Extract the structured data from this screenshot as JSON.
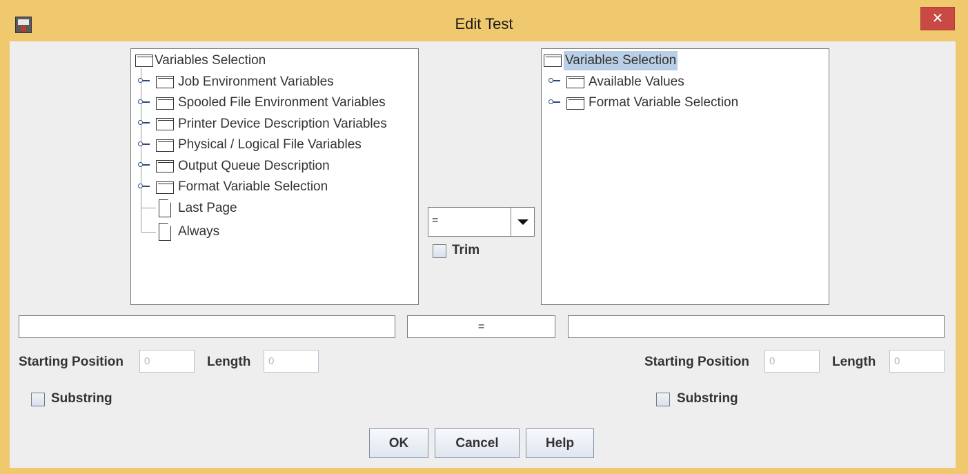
{
  "window": {
    "title": "Edit Test",
    "close_label": "✕"
  },
  "left_tree": {
    "root": "Variables Selection",
    "items": [
      "Job Environment Variables",
      "Spooled File Environment Variables",
      "Printer Device Description Variables",
      "Physical / Logical File Variables",
      "Output Queue Description",
      "Format Variable Selection",
      "Last Page",
      "Always"
    ]
  },
  "right_tree": {
    "root": "Variables Selection",
    "items": [
      "Available Values",
      "Format Variable Selection"
    ]
  },
  "operator": {
    "selected": "="
  },
  "trim": {
    "label": "Trim",
    "checked": false
  },
  "expression": {
    "left": "",
    "operator": "=",
    "right": ""
  },
  "left_sub": {
    "start_label": "Starting Position",
    "start_value": "0",
    "length_label": "Length",
    "length_value": "0",
    "substring_label": "Substring"
  },
  "right_sub": {
    "start_label": "Starting Position",
    "start_value": "0",
    "length_label": "Length",
    "length_value": "0",
    "substring_label": "Substring"
  },
  "buttons": {
    "ok": "OK",
    "cancel": "Cancel",
    "help": "Help"
  }
}
